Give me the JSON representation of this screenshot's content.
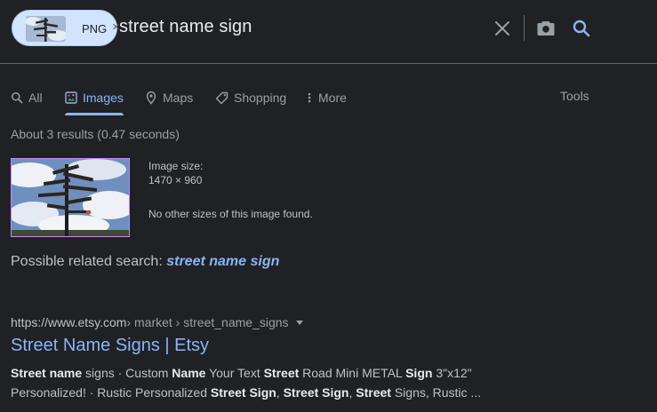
{
  "search": {
    "chip_label": "PNG",
    "chip_remove": "×",
    "query": "street name sign"
  },
  "tabs": [
    {
      "label": "All",
      "icon": "search-icon",
      "active": false
    },
    {
      "label": "Images",
      "icon": "image-icon",
      "active": true
    },
    {
      "label": "Maps",
      "icon": "map-pin-icon",
      "active": false
    },
    {
      "label": "Shopping",
      "icon": "tag-icon",
      "active": false
    },
    {
      "label": "More",
      "icon": "more-vert-icon",
      "active": false
    }
  ],
  "tools_label": "Tools",
  "stats": "About 3 results (0.47 seconds)",
  "image_info": {
    "size_label": "Image size:",
    "size_value": "1470 × 960",
    "no_other": "No other sizes of this image found."
  },
  "related": {
    "prefix": "Possible related search:",
    "query": "street name sign"
  },
  "result": {
    "domain": "https://www.etsy.com",
    "path": " › market › street_name_signs",
    "title": "Street Name Signs | Etsy",
    "snippet_line1": [
      {
        "t": "Street",
        "b": true
      },
      {
        "t": " ",
        "b": false
      },
      {
        "t": "name",
        "b": true
      },
      {
        "t": " signs · Custom ",
        "b": false
      },
      {
        "t": "Name",
        "b": true
      },
      {
        "t": " Your Text ",
        "b": false
      },
      {
        "t": "Street",
        "b": true
      },
      {
        "t": " Road Mini METAL ",
        "b": false
      },
      {
        "t": "Sign",
        "b": true
      },
      {
        "t": " 3\"x12\"",
        "b": false
      }
    ],
    "snippet_line2": [
      {
        "t": "Personalized! · Rustic Personalized ",
        "b": false
      },
      {
        "t": "Street Sign",
        "b": true
      },
      {
        "t": ", ",
        "b": false
      },
      {
        "t": "Street Sign",
        "b": true
      },
      {
        "t": ", ",
        "b": false
      },
      {
        "t": "Street",
        "b": true
      },
      {
        "t": " Signs, Rustic ...",
        "b": false
      }
    ]
  },
  "colors": {
    "background": "#202124",
    "accent": "#8ab4f8",
    "chip": "#d2e3fc",
    "thumb_border": "#c58af9"
  }
}
